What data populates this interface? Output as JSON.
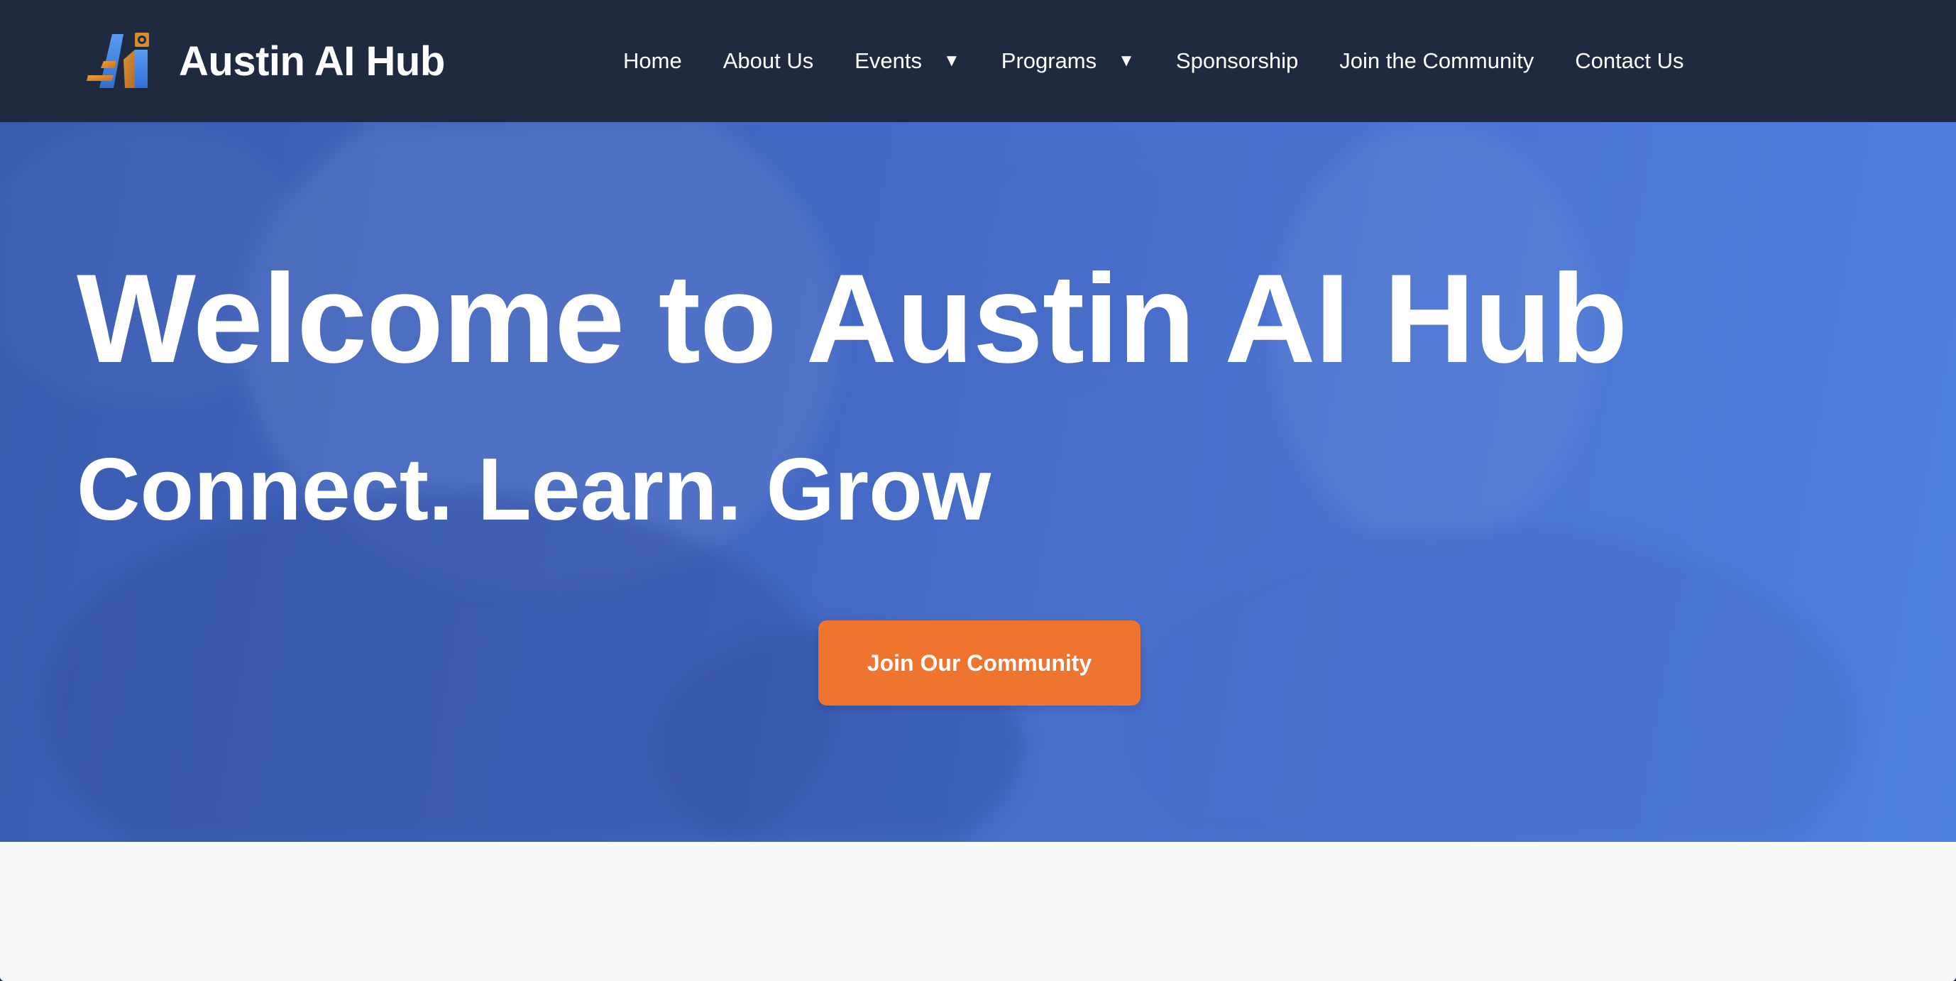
{
  "brand": {
    "name": "Austin AI Hub",
    "logo_icon": "ai-letters-logo"
  },
  "nav": {
    "items": [
      {
        "label": "Home",
        "has_dropdown": false
      },
      {
        "label": "About Us",
        "has_dropdown": false
      },
      {
        "label": "Events",
        "has_dropdown": true
      },
      {
        "label": "Programs",
        "has_dropdown": true
      },
      {
        "label": "Sponsorship",
        "has_dropdown": false
      },
      {
        "label": "Join the Community",
        "has_dropdown": false
      },
      {
        "label": "Contact Us",
        "has_dropdown": false
      }
    ],
    "caret_glyph": "▼"
  },
  "hero": {
    "title": "Welcome to Austin AI Hub",
    "subtitle": "Connect. Learn. Grow",
    "cta_label": "Join Our Community"
  },
  "colors": {
    "navbar_bg": "#1f2a40",
    "hero_overlay": "#4a74d2",
    "cta_bg": "#ee7430",
    "page_bg": "#f7f8fa"
  }
}
